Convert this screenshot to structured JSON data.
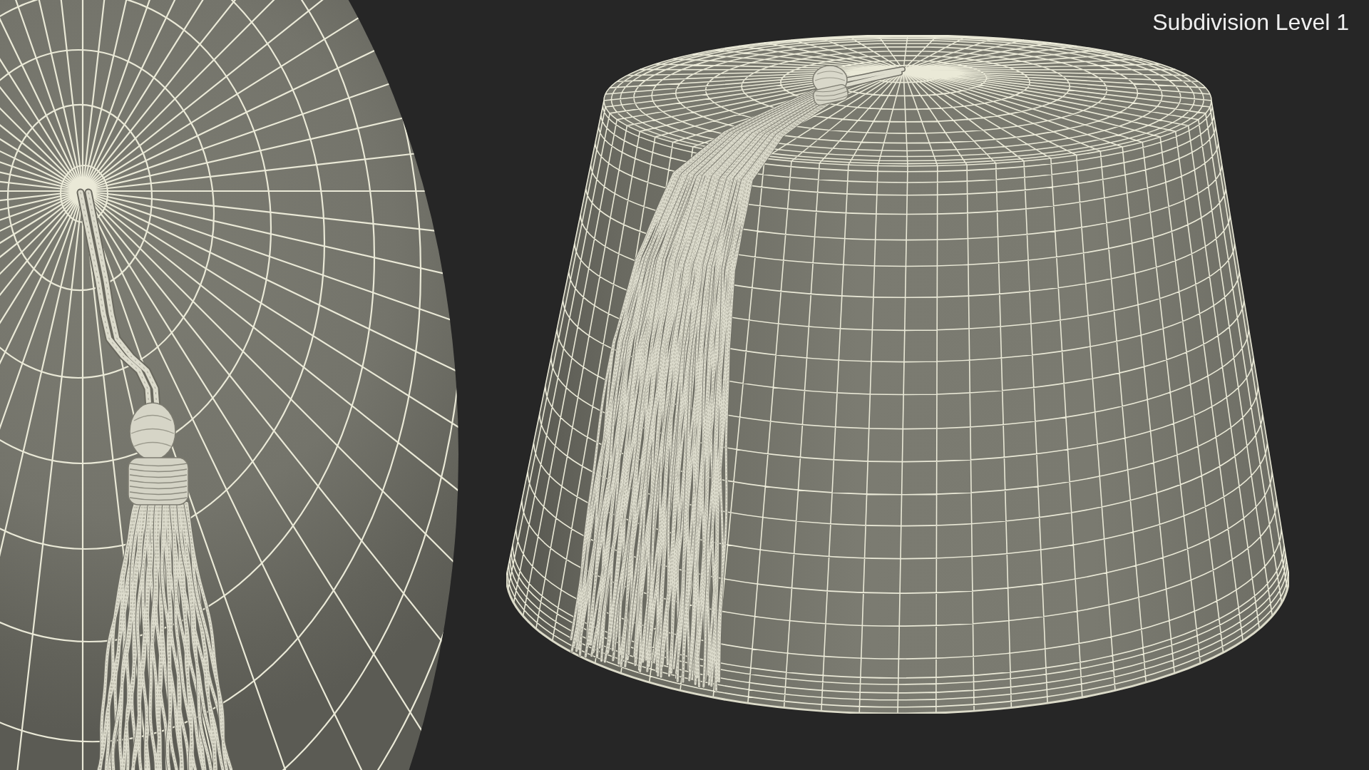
{
  "viewport": {
    "label": "Subdivision Level 1"
  }
}
